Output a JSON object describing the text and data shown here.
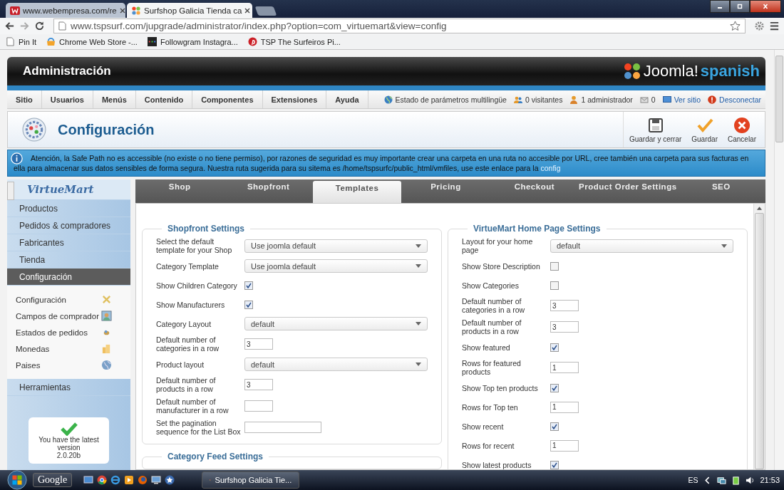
{
  "browser": {
    "tabs": [
      {
        "title": "www.webempresa.com/re",
        "kind": "webempresa",
        "selected": false
      },
      {
        "title": "Surfshop Galicia Tienda ca",
        "kind": "joomla",
        "selected": true
      }
    ],
    "url": "www.tspsurf.com/jupgrade/administrator/index.php?option=com_virtuemart&view=config",
    "bookmarks": [
      {
        "label": "Pin It",
        "kind": "page"
      },
      {
        "label": "Chrome Web Store -...",
        "kind": "store"
      },
      {
        "label": "Followgram Instagra...",
        "kind": "dots"
      },
      {
        "label": "TSP The Surfeiros Pi...",
        "kind": "pinterest"
      }
    ]
  },
  "header": {
    "title": "Administración",
    "logo": "Joomla!",
    "logo_language": "spanish"
  },
  "menu": {
    "items": [
      "Sitio",
      "Usuarios",
      "Menús",
      "Contenido",
      "Componentes",
      "Extensiones",
      "Ayuda"
    ],
    "status": [
      {
        "kind": "globe",
        "text": "Estado de parámetros multilingüe"
      },
      {
        "kind": "users",
        "text": "0 visitantes"
      },
      {
        "kind": "user",
        "text": "1 administrador"
      },
      {
        "kind": "mail",
        "text": "0"
      },
      {
        "kind": "monitor",
        "text": "Ver sitio"
      },
      {
        "kind": "power",
        "text": "Desconectar"
      }
    ]
  },
  "toolbar": {
    "title": "Configuración",
    "buttons": [
      {
        "kind": "save-close",
        "label": "Guardar y cerrar"
      },
      {
        "kind": "save",
        "label": "Guardar"
      },
      {
        "kind": "cancel",
        "label": "Cancelar"
      }
    ]
  },
  "alert": {
    "text": "Atención, la Safe Path no es accessible (no existe o no tiene permiso), por razones de seguridad es muy importante crear una carpeta en una ruta no accesible por URL, cree también una carpeta para sus facturas en ella para almacenar sus datos sensibles de forma segura. Nuestra ruta sugerida para su sitema es /home/tspsurfc/public_html/vmfiles, use este enlace para la",
    "link": "config"
  },
  "sidebar": {
    "logo": "VirtueMart",
    "items": [
      {
        "label": "Productos",
        "selected": false
      },
      {
        "label": "Pedidos & compradores",
        "selected": false
      },
      {
        "label": "Fabricantes",
        "selected": false
      },
      {
        "label": "Tienda",
        "selected": false
      },
      {
        "label": "Configuración",
        "selected": true,
        "children": [
          {
            "label": "Configuración",
            "kind": "tools"
          },
          {
            "label": "Campos de comprador",
            "kind": "users"
          },
          {
            "label": "Estados de pedidos",
            "kind": "status"
          },
          {
            "label": "Monedas",
            "kind": "coins"
          },
          {
            "label": "Paises",
            "kind": "globe"
          }
        ]
      },
      {
        "label": "Herramientas",
        "selected": false
      }
    ],
    "version": {
      "message": "You have the latest version",
      "number": "2.0.20b"
    }
  },
  "tabs": [
    {
      "label": "Shop",
      "selected": false
    },
    {
      "label": "Shopfront",
      "selected": false
    },
    {
      "label": "Templates",
      "selected": true
    },
    {
      "label": "Pricing",
      "selected": false
    },
    {
      "label": "Checkout",
      "selected": false
    },
    {
      "label": "Product Order Settings",
      "selected": false
    },
    {
      "label": "SEO",
      "selected": false
    }
  ],
  "columns": [
    [
      {
        "legend": "Shopfront Settings",
        "fields": [
          {
            "label": "Select the default template for your Shop",
            "kind": "select",
            "value": "Use joomla default"
          },
          {
            "label": "Category Template",
            "kind": "select",
            "value": "Use joomla default"
          },
          {
            "label": "Show Children Category",
            "kind": "checkbox",
            "checked": true
          },
          {
            "label": "Show Manufacturers",
            "kind": "checkbox",
            "checked": true
          },
          {
            "label": "Category Layout",
            "kind": "select",
            "value": "default"
          },
          {
            "label": "Default number of categories in a row",
            "kind": "text",
            "value": "3"
          },
          {
            "label": "Product layout",
            "kind": "select",
            "value": "default"
          },
          {
            "label": "Default number of products in a row",
            "kind": "text",
            "value": "3"
          },
          {
            "label": "Default number of manufacturer in a row",
            "kind": "text"
          },
          {
            "label": "Set the pagination sequence for the List Box",
            "kind": "wide-text"
          }
        ]
      },
      {
        "legend": "Category Feed Settings"
      }
    ],
    [
      {
        "legend": "VirtueMart Home Page Settings",
        "fields": [
          {
            "label": "Layout for your home page",
            "kind": "select",
            "value": "default"
          },
          {
            "label": "Show Store Description",
            "kind": "checkbox",
            "checked": false
          },
          {
            "label": "Show Categories",
            "kind": "checkbox",
            "checked": false
          },
          {
            "label": "Default number of categories in a row",
            "kind": "text",
            "value": "3"
          },
          {
            "label": "Default number of products in a row",
            "kind": "text",
            "value": "3"
          },
          {
            "label": "Show featured",
            "kind": "checkbox",
            "checked": true
          },
          {
            "label": "Rows for featured products",
            "kind": "text",
            "value": "1"
          },
          {
            "label": "Show Top ten products",
            "kind": "checkbox",
            "checked": true
          },
          {
            "label": "Rows for Top ten",
            "kind": "text",
            "value": "1"
          },
          {
            "label": "Show recent",
            "kind": "checkbox",
            "checked": true
          },
          {
            "label": "Rows for recent",
            "kind": "text",
            "value": "1"
          },
          {
            "label": "Show latest products",
            "kind": "checkbox",
            "checked": true
          }
        ]
      }
    ]
  ],
  "taskbar": {
    "search": "Google",
    "windows": [
      {
        "title": "Surfshop Galicia Tie...",
        "selected": true
      }
    ],
    "language": "ES",
    "clock": "21:53"
  }
}
